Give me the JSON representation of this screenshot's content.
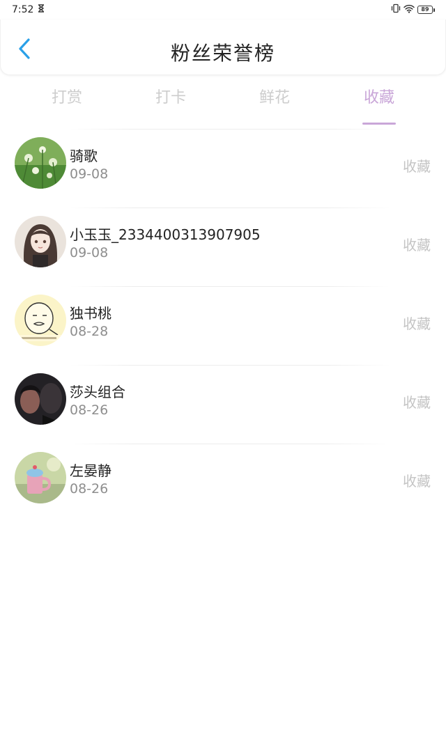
{
  "status": {
    "time": "7:52",
    "battery": "89"
  },
  "header": {
    "title": "粉丝荣誉榜"
  },
  "tabs": [
    {
      "label": "打赏"
    },
    {
      "label": "打卡"
    },
    {
      "label": "鲜花"
    },
    {
      "label": "收藏",
      "active": true
    }
  ],
  "colors": {
    "accent": "#c9a6d8",
    "back": "#2aa0e8",
    "inactive_tab": "#cdcdcd"
  },
  "fans": [
    {
      "name": "骑歌",
      "date": "09-08",
      "tag": "收藏",
      "avatar": "green-flower-field"
    },
    {
      "name": "小玉玉_2334400313907905",
      "date": "09-08",
      "tag": "收藏",
      "avatar": "anime-girl"
    },
    {
      "name": "独书桃",
      "date": "08-28",
      "tag": "收藏",
      "avatar": "meme-face"
    },
    {
      "name": "莎头组合",
      "date": "08-26",
      "tag": "收藏",
      "avatar": "dark-portrait"
    },
    {
      "name": "左晏静",
      "date": "08-26",
      "tag": "收藏",
      "avatar": "cupcake-mug"
    }
  ]
}
